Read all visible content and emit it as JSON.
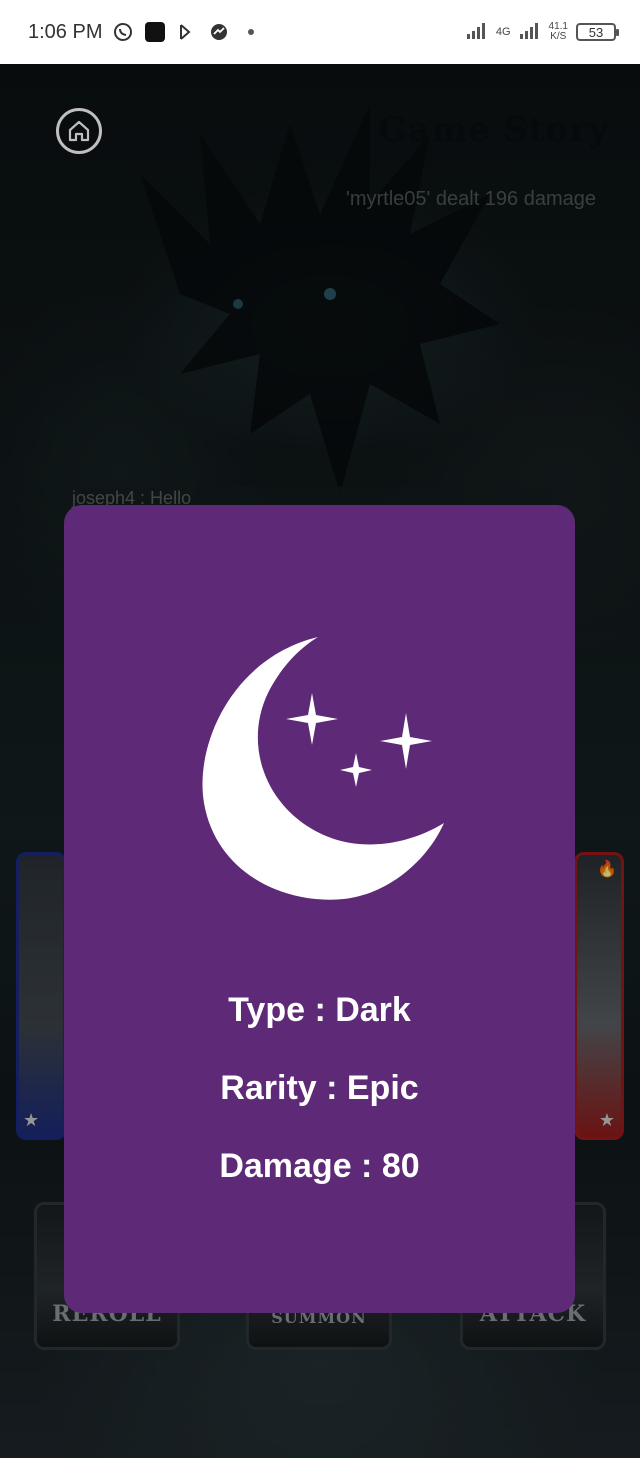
{
  "status_bar": {
    "time": "1:06 PM",
    "network": "4G",
    "speed_value": "41.1",
    "speed_unit": "K/S",
    "battery": "53",
    "icons": [
      "whatsapp-icon",
      "app-icon",
      "media-icon",
      "messenger-icon",
      "dot-icon"
    ]
  },
  "game": {
    "title": "Game Story",
    "log_message": "'myrtle05' dealt 196 damage",
    "chat_preview": "joseph4 : Hello",
    "home_icon": "home-icon",
    "actions": [
      "REROLL",
      "SUMMON",
      "ATTACK"
    ]
  },
  "card": {
    "icon": "moon-stars-icon",
    "color": "#5e2976",
    "type_text": "Type : Dark",
    "rarity_text": "Rarity : Epic",
    "damage_text": "Damage : 80"
  }
}
